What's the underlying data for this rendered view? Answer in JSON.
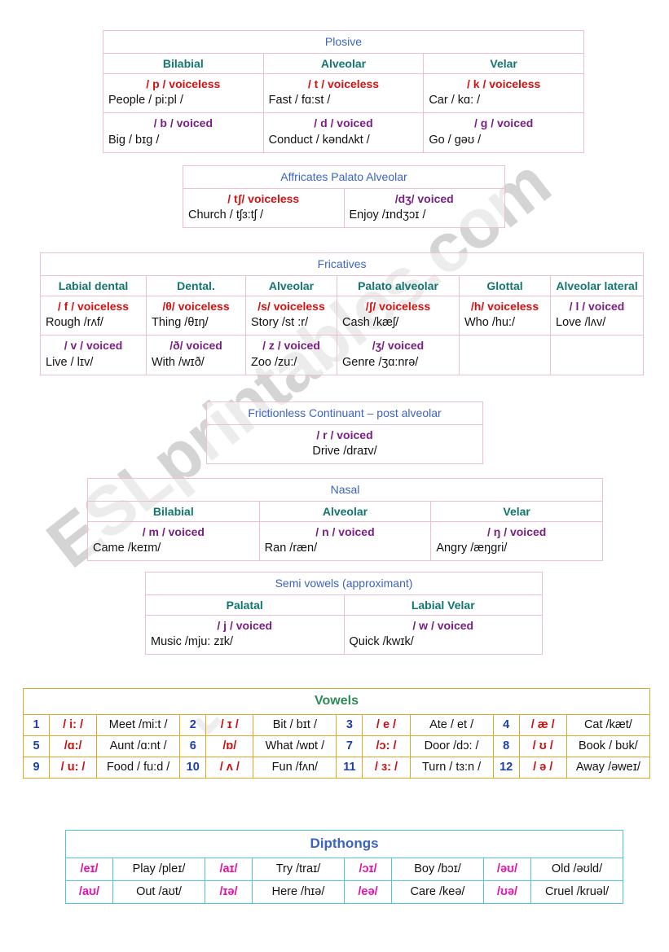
{
  "watermark": {
    "text": "ESLprintables.com",
    "chevron": "⌄"
  },
  "plosive": {
    "title": "Plosive",
    "places": [
      "Bilabial",
      "Alveolar",
      "Velar"
    ],
    "rows": [
      {
        "voicing": "voiceless",
        "cells": [
          {
            "symbol": "/ p / voiceless",
            "example": "People / pi:pl /"
          },
          {
            "symbol": "/ t / voiceless",
            "example": "Fast / fɑ:st /"
          },
          {
            "symbol": "/ k / voiceless",
            "example": "Car / kɑ: /"
          }
        ]
      },
      {
        "voicing": "voiced",
        "cells": [
          {
            "symbol": "/ b / voiced",
            "example": "Big / bɪg /"
          },
          {
            "symbol": "/ d / voiced",
            "example": "Conduct / kəndʌkt /"
          },
          {
            "symbol": "/ g / voiced",
            "example": "Go / gəʊ /"
          }
        ]
      }
    ]
  },
  "affricates": {
    "title": "Affricates Palato Alveolar",
    "cells": [
      {
        "symbol": "/ tʃ/ voiceless",
        "example": "Church / tʃɜ:tʃ /"
      },
      {
        "symbol": "/dʒ/ voiced",
        "example": "Enjoy /ɪndʒɔɪ /"
      }
    ]
  },
  "fricatives": {
    "title": "Fricatives",
    "places": [
      "Labial dental",
      "Dental.",
      "Alveolar",
      "Palato alveolar",
      "Glottal",
      "Alveolar lateral"
    ],
    "rows": [
      {
        "voicing": "voiceless",
        "cells": [
          {
            "symbol": "/ f / voiceless",
            "example": "Rough /rʌf/"
          },
          {
            "symbol": "/θ/ voiceless",
            "example": "Thing /θɪŋ/"
          },
          {
            "symbol": "/s/ voiceless",
            "example": "Story /st :r/"
          },
          {
            "symbol": "/ʃ/ voiceless",
            "example": "Cash /kæʃ/"
          },
          {
            "symbol": "/h/ voiceless",
            "example": "Who /hu:/"
          },
          {
            "symbol": "/ l / voiced",
            "example": "Love /lʌv/"
          }
        ]
      },
      {
        "voicing": "voiced",
        "cells": [
          {
            "symbol": "/ v / voiced",
            "example": "Live / lɪv/"
          },
          {
            "symbol": "/ð/ voiced",
            "example": "With /wɪð/"
          },
          {
            "symbol": "/ z /  voiced",
            "example": "Zoo /zu:/"
          },
          {
            "symbol": "/ʒ/ voiced",
            "example": "Genre /ʒɑ:nrə/"
          },
          {
            "symbol": "",
            "example": ""
          },
          {
            "symbol": "",
            "example": ""
          }
        ]
      }
    ]
  },
  "frictionless": {
    "title": "Frictionless Continuant – post alveolar",
    "symbol": "/ r / voiced",
    "example": "Drive /draɪv/"
  },
  "nasal": {
    "title": "Nasal",
    "places": [
      "Bilabial",
      "Alveolar",
      "Velar"
    ],
    "cells": [
      {
        "symbol": "/ m / voiced",
        "example": "Came /keɪm/"
      },
      {
        "symbol": "/ n / voiced",
        "example": "Ran /ræn/"
      },
      {
        "symbol": "/ ŋ / voiced",
        "example": "Angry /æŋgri/"
      }
    ]
  },
  "semivowels": {
    "title": "Semi vowels (approximant)",
    "places": [
      "Palatal",
      "Labial Velar"
    ],
    "cells": [
      {
        "symbol": "/ j / voiced",
        "example": "Music /mju: zɪk/"
      },
      {
        "symbol": "/ w / voiced",
        "example": "Quick /kwɪk/"
      }
    ]
  },
  "vowels": {
    "title": "Vowels",
    "entries": [
      {
        "num": "1",
        "symbol": "/ i: /",
        "word": "Meet  /mi:t /"
      },
      {
        "num": "2",
        "symbol": "/ ɪ /",
        "word": "Bit / bɪt /"
      },
      {
        "num": "3",
        "symbol": "/ e /",
        "word": "Ate / et /"
      },
      {
        "num": "4",
        "symbol": "/ æ /",
        "word": "Cat /kæt/"
      },
      {
        "num": "5",
        "symbol": "/ɑ:/",
        "word": "Aunt /ɑ:nt /"
      },
      {
        "num": "6",
        "symbol": "/ɒ/",
        "word": "What /wɒt /"
      },
      {
        "num": "7",
        "symbol": "/ɔ: /",
        "word": "Door /dɔ: /"
      },
      {
        "num": "8",
        "symbol": "/ ʊ /",
        "word": "Book / bʊk/"
      },
      {
        "num": "9",
        "symbol": "/ u: /",
        "word": "Food / fu:d /"
      },
      {
        "num": "10",
        "symbol": "/ ʌ /",
        "word": "Fun /fʌn/"
      },
      {
        "num": "11",
        "symbol": "/ ɜ: /",
        "word": "Turn / tɜ:n /"
      },
      {
        "num": "12",
        "symbol": "/ ə /",
        "word": "Away /əweɪ/"
      }
    ]
  },
  "dipthongs": {
    "title": "Dipthongs",
    "entries": [
      {
        "symbol": "/eɪ/",
        "word": "Play /pleɪ/"
      },
      {
        "symbol": "/aɪ/",
        "word": "Try /traɪ/"
      },
      {
        "symbol": "/ɔɪ/",
        "word": "Boy /bɔɪ/"
      },
      {
        "symbol": "/əʊ/",
        "word": "Old /əʊld/"
      },
      {
        "symbol": "/aʊ/",
        "word": "Out /aʊt/"
      },
      {
        "symbol": "/ɪə/",
        "word": "Here /hɪə/"
      },
      {
        "symbol": "/eə/",
        "word": "Care /keə/"
      },
      {
        "symbol": "/ʊə/",
        "word": "Cruel /kruəl/"
      }
    ]
  },
  "colors": {
    "section_title": "#3b63c4",
    "place_label": "#13766e",
    "voiceless": "#d51111",
    "voiced": "#7a1f86",
    "example": "#111111",
    "vowel_title": "#2e8b57",
    "vowel_number": "#1d3fa8",
    "vowel_symbol": "#c81010",
    "vowel_border": "#dca72b",
    "dipthong_symbol": "#e312a8",
    "dipthong_border": "#4ec9d4",
    "consonant_border": "#edbfcf"
  }
}
